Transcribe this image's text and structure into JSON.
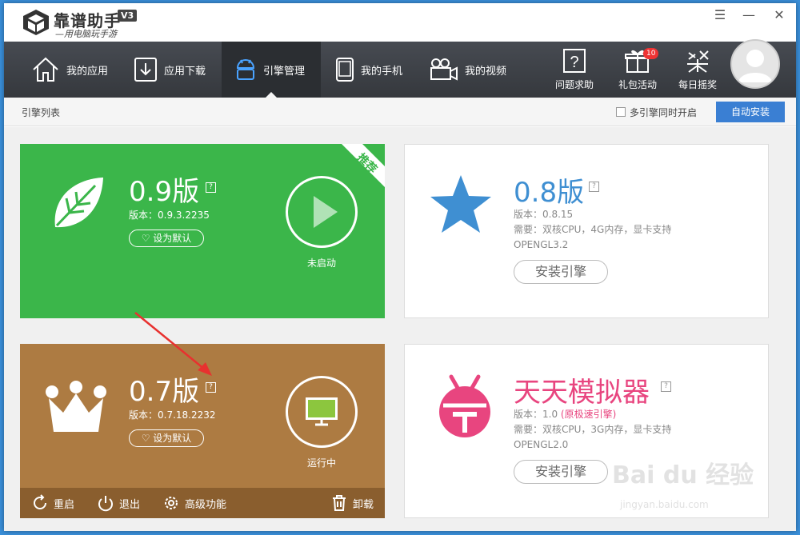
{
  "app": {
    "name": "靠谱助手",
    "version": "V3",
    "slogan": "—用电脑玩手游"
  },
  "window_controls": {
    "menu": "☰",
    "minimize": "—",
    "close": "✕"
  },
  "nav": {
    "items": [
      {
        "label": "我的应用",
        "icon": "home-icon"
      },
      {
        "label": "应用下载",
        "icon": "download-icon"
      },
      {
        "label": "引擎管理",
        "icon": "android-icon"
      },
      {
        "label": "我的手机",
        "icon": "phone-icon"
      },
      {
        "label": "我的视频",
        "icon": "video-icon"
      }
    ],
    "right": [
      {
        "label": "问题求助",
        "icon": "help-icon"
      },
      {
        "label": "礼包活动",
        "icon": "gift-icon",
        "badge": "10"
      },
      {
        "label": "每日摇奖",
        "icon": "lottery-icon"
      }
    ]
  },
  "subbar": {
    "title": "引擎列表",
    "multi_label": "多引擎同时开启",
    "auto_install": "自动安装"
  },
  "engines": {
    "e09": {
      "title": "0.9版",
      "version": "版本：0.9.3.2235",
      "default_btn": "设为默认",
      "status": "未启动",
      "ribbon": "推荐",
      "help": "?"
    },
    "e07": {
      "title": "0.7版",
      "version": "版本：0.7.18.2232",
      "default_btn": "设为默认",
      "status": "运行中",
      "help": "?",
      "footer": {
        "restart": "重启",
        "quit": "退出",
        "advanced": "高级功能",
        "uninstall": "卸载"
      }
    },
    "e08": {
      "title": "0.8版",
      "version": "版本：0.8.15",
      "require": "需要：双核CPU，4G内存，显卡支持",
      "opengl": "OPENGL3.2",
      "install": "安装引擎",
      "help": "?"
    },
    "tt": {
      "title": "天天模拟器",
      "version_prefix": "版本：1.0",
      "version_note": "(原极速引擎)",
      "require": "需要：双核CPU，3G内存，显卡支持",
      "opengl": "OPENGL2.0",
      "install": "安装引擎",
      "help": "?"
    }
  },
  "watermark": {
    "brand": "Bai du 经验",
    "url": "jingyan.baidu.com"
  },
  "colors": {
    "green": "#3bb64a",
    "brown": "#ad7b42",
    "blue_title": "#3f8fd2",
    "pink": "#e8457f",
    "accent": "#3a7fd3"
  }
}
